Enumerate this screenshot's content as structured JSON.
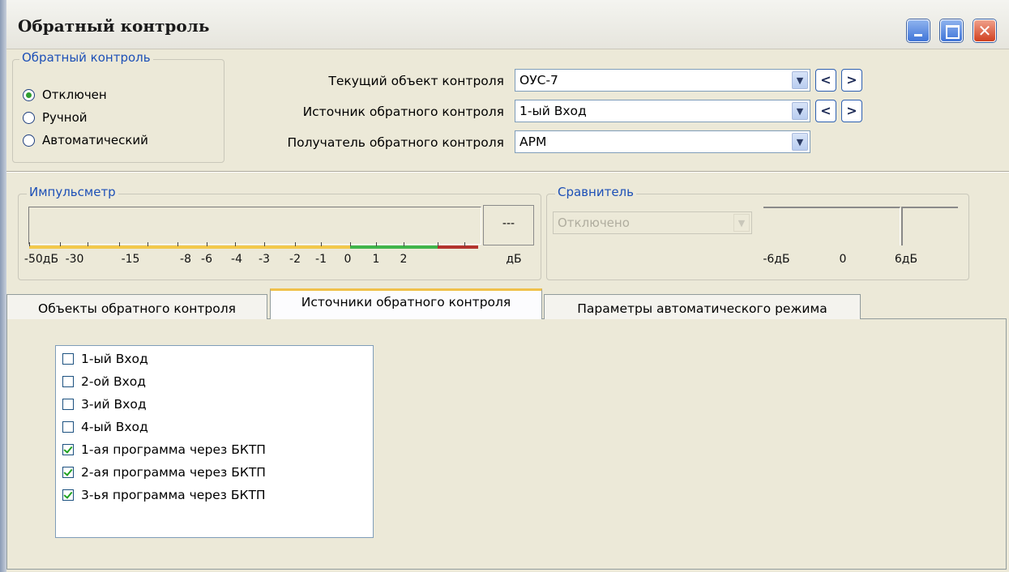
{
  "window": {
    "title": "Обратный контроль"
  },
  "mode_group": {
    "legend": "Обратный контроль",
    "options": [
      "Отключен",
      "Ручной",
      "Автоматический"
    ],
    "selected": "Отключен"
  },
  "fields": {
    "current_object_label": "Текущий объект контроля",
    "current_object_value": "ОУС-7",
    "source_label": "Источник обратного контроля",
    "source_value": "1-ый Вход",
    "receiver_label": "Получатель обратного контроля",
    "receiver_value": "АРМ",
    "prev_label": "<",
    "next_label": ">"
  },
  "pulse_meter": {
    "legend": "Импульсметр",
    "readout": "---",
    "scale_labels": [
      "-50дБ",
      "-30",
      "-15",
      "-8",
      "-6",
      "-4",
      "-3",
      "-2",
      "-1",
      "0",
      "1",
      "2"
    ],
    "unit": "дБ",
    "zone_colors": {
      "low": "#f2c84b",
      "mid": "#3fb54a",
      "high": "#b3332d"
    }
  },
  "comparator": {
    "legend": "Сравнитель",
    "state_value": "Отключено",
    "scale_labels": [
      "-6дБ",
      "0",
      "6дБ"
    ]
  },
  "tabs": [
    {
      "label": "Объекты обратного контроля",
      "active": false
    },
    {
      "label": "Источники обратного контроля",
      "active": true
    },
    {
      "label": "Параметры автоматического режима",
      "active": false
    }
  ],
  "sources": [
    {
      "label": "1-ый Вход",
      "checked": false
    },
    {
      "label": "2-ой Вход",
      "checked": false
    },
    {
      "label": "3-ий Вход",
      "checked": false
    },
    {
      "label": "4-ый Вход",
      "checked": false
    },
    {
      "label": "1-ая программа через БКТП",
      "checked": true
    },
    {
      "label": "2-ая программа через БКТП",
      "checked": true
    },
    {
      "label": "3-ья программа через БКТП",
      "checked": true
    }
  ]
}
